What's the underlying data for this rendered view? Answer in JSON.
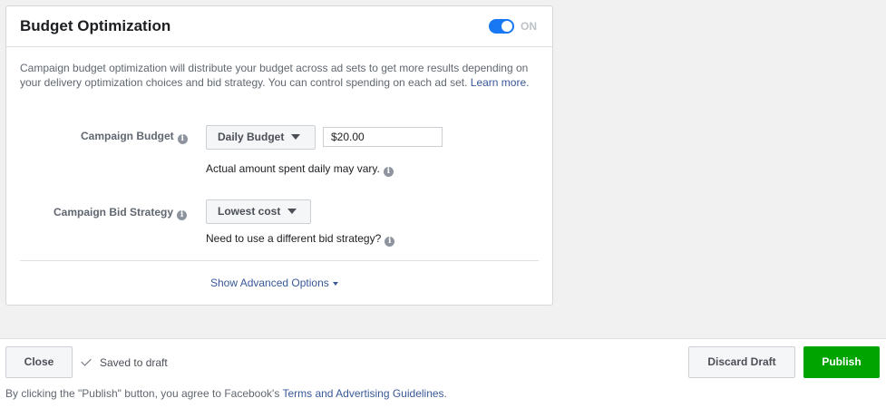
{
  "card": {
    "title": "Budget Optimization",
    "toggle_state": "ON",
    "description": "Campaign budget optimization will distribute your budget across ad sets to get more results depending on your delivery optimization choices and bid strategy. You can control spending on each ad set.",
    "learn_more": "Learn more."
  },
  "budget": {
    "label": "Campaign Budget",
    "type_value": "Daily Budget",
    "amount_value": "$20.00",
    "help": "Actual amount spent daily may vary."
  },
  "bid": {
    "label": "Campaign Bid Strategy",
    "strategy_value": "Lowest cost",
    "help": "Need to use a different bid strategy?"
  },
  "advanced": {
    "label": "Show Advanced Options"
  },
  "footer": {
    "close_label": "Close",
    "saved_label": "Saved to draft",
    "discard_label": "Discard Draft",
    "publish_label": "Publish",
    "legal_prefix": "By clicking the \"Publish\" button, you agree to Facebook's",
    "legal_link": "Terms and Advertising Guidelines",
    "legal_suffix": "."
  },
  "colors": {
    "accent": "#1877f2",
    "link": "#385898",
    "publish": "#00a400"
  },
  "icons": [
    "info-icon",
    "chevron-down-icon",
    "check-icon",
    "toggle-switch"
  ]
}
